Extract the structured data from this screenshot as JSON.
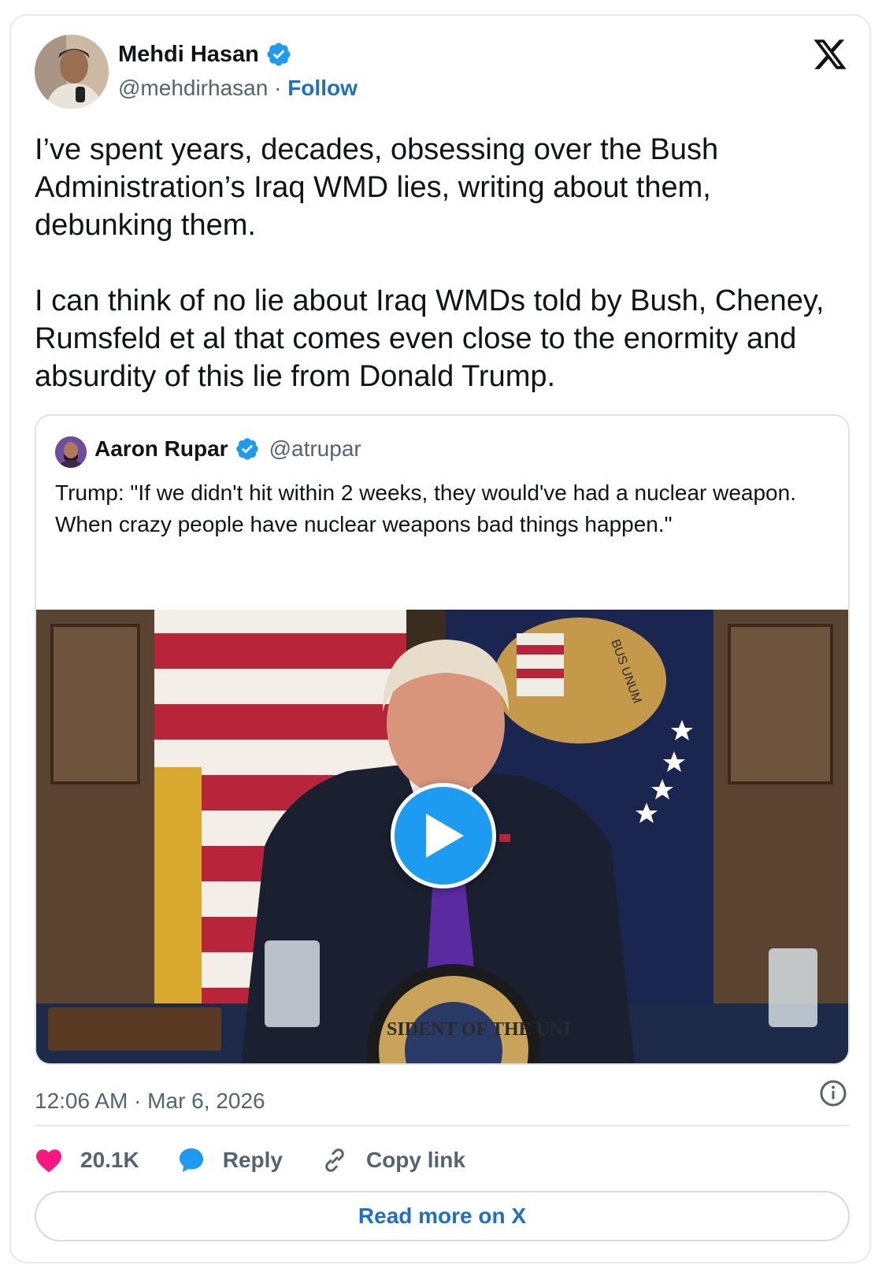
{
  "author": {
    "name": "Mehdi Hasan",
    "handle": "@mehdirhasan",
    "separator": " · ",
    "follow_label": "Follow"
  },
  "tweet": {
    "paragraphs": [
      "I’ve spent years, decades, obsessing over the Bush Administration’s Iraq WMD lies, writing about them, debunking them.",
      "I can think of no lie about Iraq WMDs told by Bush, Cheney, Rumsfeld et al that comes even close to the enormity and absurdity of this lie from Donald Trump."
    ],
    "timestamp": "12:06 AM · Mar 6, 2026"
  },
  "quoted_tweet": {
    "name": "Aaron Rupar",
    "handle": "@atrupar",
    "text": "Trump: \"If we didn't hit within 2 weeks, they would've had a nuclear weapon. When crazy people have nuclear weapons bad things happen.\"",
    "media": {
      "type": "video",
      "seal_text": "SIDENT OF THE UNI",
      "flag_text": "BUS UNUM"
    }
  },
  "actions": {
    "likes_count": "20.1K",
    "reply_label": "Reply",
    "copy_link_label": "Copy link"
  },
  "read_more_label": "Read more on X",
  "colors": {
    "accent": "#1d9bf0",
    "link": "#1d70c2",
    "like": "#f91880",
    "muted": "#536471"
  }
}
